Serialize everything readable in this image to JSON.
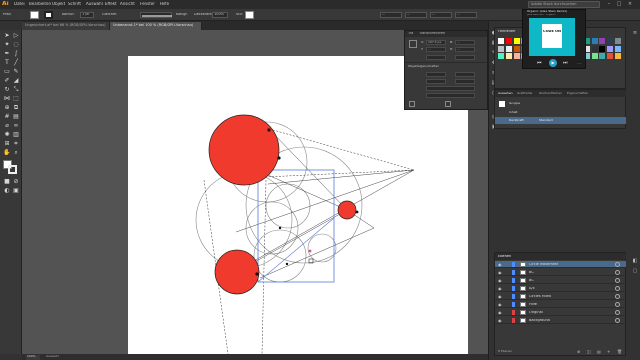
{
  "app": {
    "logo": "Ai",
    "menus": [
      "Datei",
      "Bearbeiten",
      "Objekt",
      "Schrift",
      "Auswahl",
      "Effekt",
      "Ansicht",
      "Fenster",
      "Hilfe"
    ],
    "search_placeholder": "Adobe Stock durchsuchen"
  },
  "controlbar": {
    "selection_label": "Pfad",
    "stroke_label": "Kontur:",
    "stroke_value": "1 pt",
    "profile_label": "Gleichm.",
    "brush_label": "Kalligr.",
    "opacity_label": "Deckkraft:",
    "opacity_value": "100%",
    "style_label": "Stil:",
    "x_value": "...",
    "y_value": "...",
    "w_value": "...",
    "h_value": "..."
  },
  "tabs": [
    {
      "label": "Ungesichert.ai* bei 66 % (RGB/GPU-Vorschau)",
      "active": false
    },
    {
      "label": "Unbenannt-1* bei 100 % (RGB/GPU-Vorschau)",
      "active": true
    }
  ],
  "toolbar": {
    "icons": [
      "selection-arrow",
      "direct-select",
      "magic-wand",
      "lasso",
      "pen",
      "curvature",
      "type",
      "line",
      "rectangle",
      "paintbrush",
      "shaper",
      "eraser",
      "rotate",
      "scale",
      "width",
      "free-transform",
      "shape-builder",
      "perspective",
      "mesh",
      "gradient",
      "eyedropper",
      "blend",
      "symbol-sprayer",
      "column-graph",
      "artboard",
      "slice",
      "hand",
      "zoom"
    ]
  },
  "transform_panel": {
    "tabs": [
      "Tra",
      "Transformieren"
    ],
    "x_label": "X:",
    "x_value": "197,3 px",
    "y_label": "Y:",
    "y_value": "...",
    "w_label": "B:",
    "w_value": "...",
    "h_label": "H:",
    "h_value": "...",
    "section_label": "Objekteigenschaften"
  },
  "media_player": {
    "title": "Organic (Alex Stein Remix)",
    "artist": "Julia Neuman · Organic",
    "album_text": "CODE ONE",
    "controls": [
      "prev",
      "play",
      "next"
    ]
  },
  "swatches_panel": {
    "tab": "Farbfelder",
    "colors": [
      "#ffffff",
      "#ff0000",
      "#ffff00",
      "#00ff00",
      "#00ffff",
      "#0000ff",
      "#ff00ff",
      "#c0392b",
      "#e67e22",
      "#f1c40f",
      "#27ae60",
      "#16a085",
      "#2980b9",
      "#8e44ad",
      "#2c3e50",
      "#7f8c8d",
      "#bdc3c7",
      "#ecf0f1",
      "#d35400",
      "#c0392b",
      "#e84393",
      "#6c5ce7",
      "#00b894",
      "#fdcb6e",
      "#e17055",
      "#636e72",
      "#b2bec3",
      "#dfe6e9",
      "#2d3436",
      "#000000",
      "#a29bfe",
      "#74b9ff",
      "#55efc4",
      "#ffeaa7",
      "#fab1a0",
      "#ff7675",
      "#fd79a8",
      "#81ecec",
      "#b8e994",
      "#f8c291",
      "#60a3bc",
      "#4a69bd",
      "#6a89cc",
      "#82ccdd",
      "#78e08f",
      "#38ada9",
      "#e55039",
      "#f6b93b"
    ]
  },
  "appearance_panel": {
    "tabs": [
      "Aussehen",
      "Grafikstile",
      "Zeichenflächen",
      "Eigenschaften"
    ],
    "rows": [
      "Gruppe",
      "Inhalt",
      "Deckkraft:",
      "Standard"
    ]
  },
  "layers_panel": {
    "title": "Ebenen",
    "rows": [
      {
        "name": "Circle Movement",
        "color": "#4f8cff",
        "selected": true
      },
      {
        "name": "BC",
        "color": "#4f8cff",
        "selected": false
      },
      {
        "name": "BC",
        "color": "#4f8cff",
        "selected": false
      },
      {
        "name": "A/E",
        "color": "#4f8cff",
        "selected": false
      },
      {
        "name": "Circles Filled",
        "color": "#4f8cff",
        "selected": false
      },
      {
        "name": "Hilfe",
        "color": "#4f8cff",
        "selected": false
      },
      {
        "name": "Original",
        "color": "#e04040",
        "selected": false
      },
      {
        "name": "Background",
        "color": "#e04040",
        "selected": false
      }
    ],
    "footer": "8 Ebenen"
  },
  "statusbar": {
    "zoom": "100%",
    "tool": "Auswahl"
  },
  "colors": {
    "accent": "#ff9a00",
    "selection": "#4a6a8c",
    "fill_red": "#f03a2e"
  }
}
